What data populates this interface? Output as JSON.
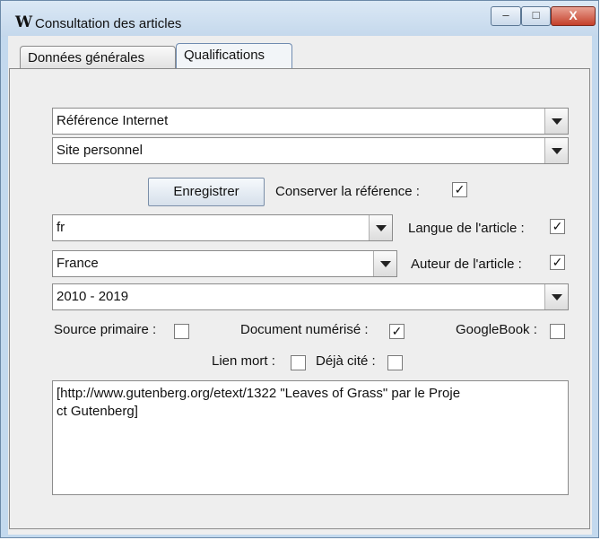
{
  "window": {
    "app_icon": "W",
    "title": "Consultation des articles",
    "controls": {
      "minimize": "–",
      "maximize": "□",
      "close": "X"
    }
  },
  "tabs": [
    {
      "label": "Données générales",
      "selected": false
    },
    {
      "label": "Qualifications",
      "selected": true
    }
  ],
  "form": {
    "reference_type": {
      "value": "Référence Internet"
    },
    "site_type": {
      "value": "Site personnel"
    },
    "save_button": "Enregistrer",
    "keep_reference": {
      "label": "Conserver la référence :",
      "checked": true
    },
    "language": {
      "value": "fr"
    },
    "language_check": {
      "label": "Langue de l'article :",
      "checked": true
    },
    "country": {
      "value": "France"
    },
    "author_check": {
      "label": "Auteur de l'article :",
      "checked": true
    },
    "period": {
      "value": "2010 - 2019"
    },
    "primary_source": {
      "label": "Source primaire :",
      "checked": false
    },
    "digitized": {
      "label": "Document numérisé :",
      "checked": true
    },
    "googlebook": {
      "label": "GoogleBook :",
      "checked": false
    },
    "dead_link": {
      "label": "Lien mort :",
      "checked": false
    },
    "already_cited": {
      "label": "Déjà cité :",
      "checked": false
    },
    "text": "[http://www.gutenberg.org/etext/1322 \"Leaves of Grass\" par le Proje\nct Gutenberg]"
  },
  "check_glyph": "✓"
}
